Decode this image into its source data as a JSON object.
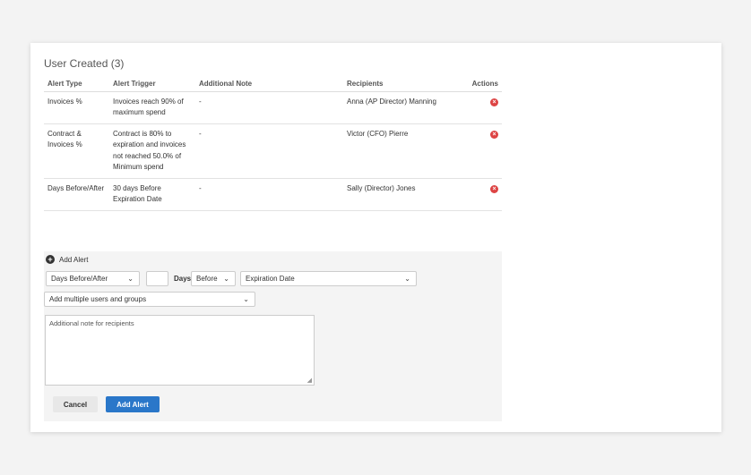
{
  "section": {
    "title": "User Created (3)"
  },
  "table": {
    "headers": [
      "Alert Type",
      "Alert Trigger",
      "Additional Note",
      "Recipients",
      "Actions"
    ],
    "rows": [
      {
        "type": "Invoices %",
        "trigger": "Invoices reach 90% of maximum spend",
        "note": "-",
        "recipients": "Anna (AP Director) Manning"
      },
      {
        "type": "Contract & Invoices %",
        "trigger": "Contract is 80% to expiration and invoices not reached 50.0% of Minimum spend",
        "note": "-",
        "recipients": "Victor (CFO) Pierre"
      },
      {
        "type": "Days Before/After",
        "trigger": "30 days Before Expiration Date",
        "note": "-",
        "recipients": "Sally (Director) Jones"
      }
    ],
    "delete_icon": "delete-circle-icon",
    "delete_color": "#dd4444"
  },
  "form": {
    "add_alert_label": "Add Alert",
    "alert_type_value": "Days Before/After",
    "days_value": "",
    "days_label": "Days",
    "direction_value": "Before",
    "date_field_value": "Expiration Date",
    "recipients_placeholder": "Add multiple users and groups",
    "note_placeholder": "Additional note for recipients",
    "cancel_label": "Cancel",
    "submit_label": "Add Alert",
    "submit_color": "#2a77c9"
  }
}
